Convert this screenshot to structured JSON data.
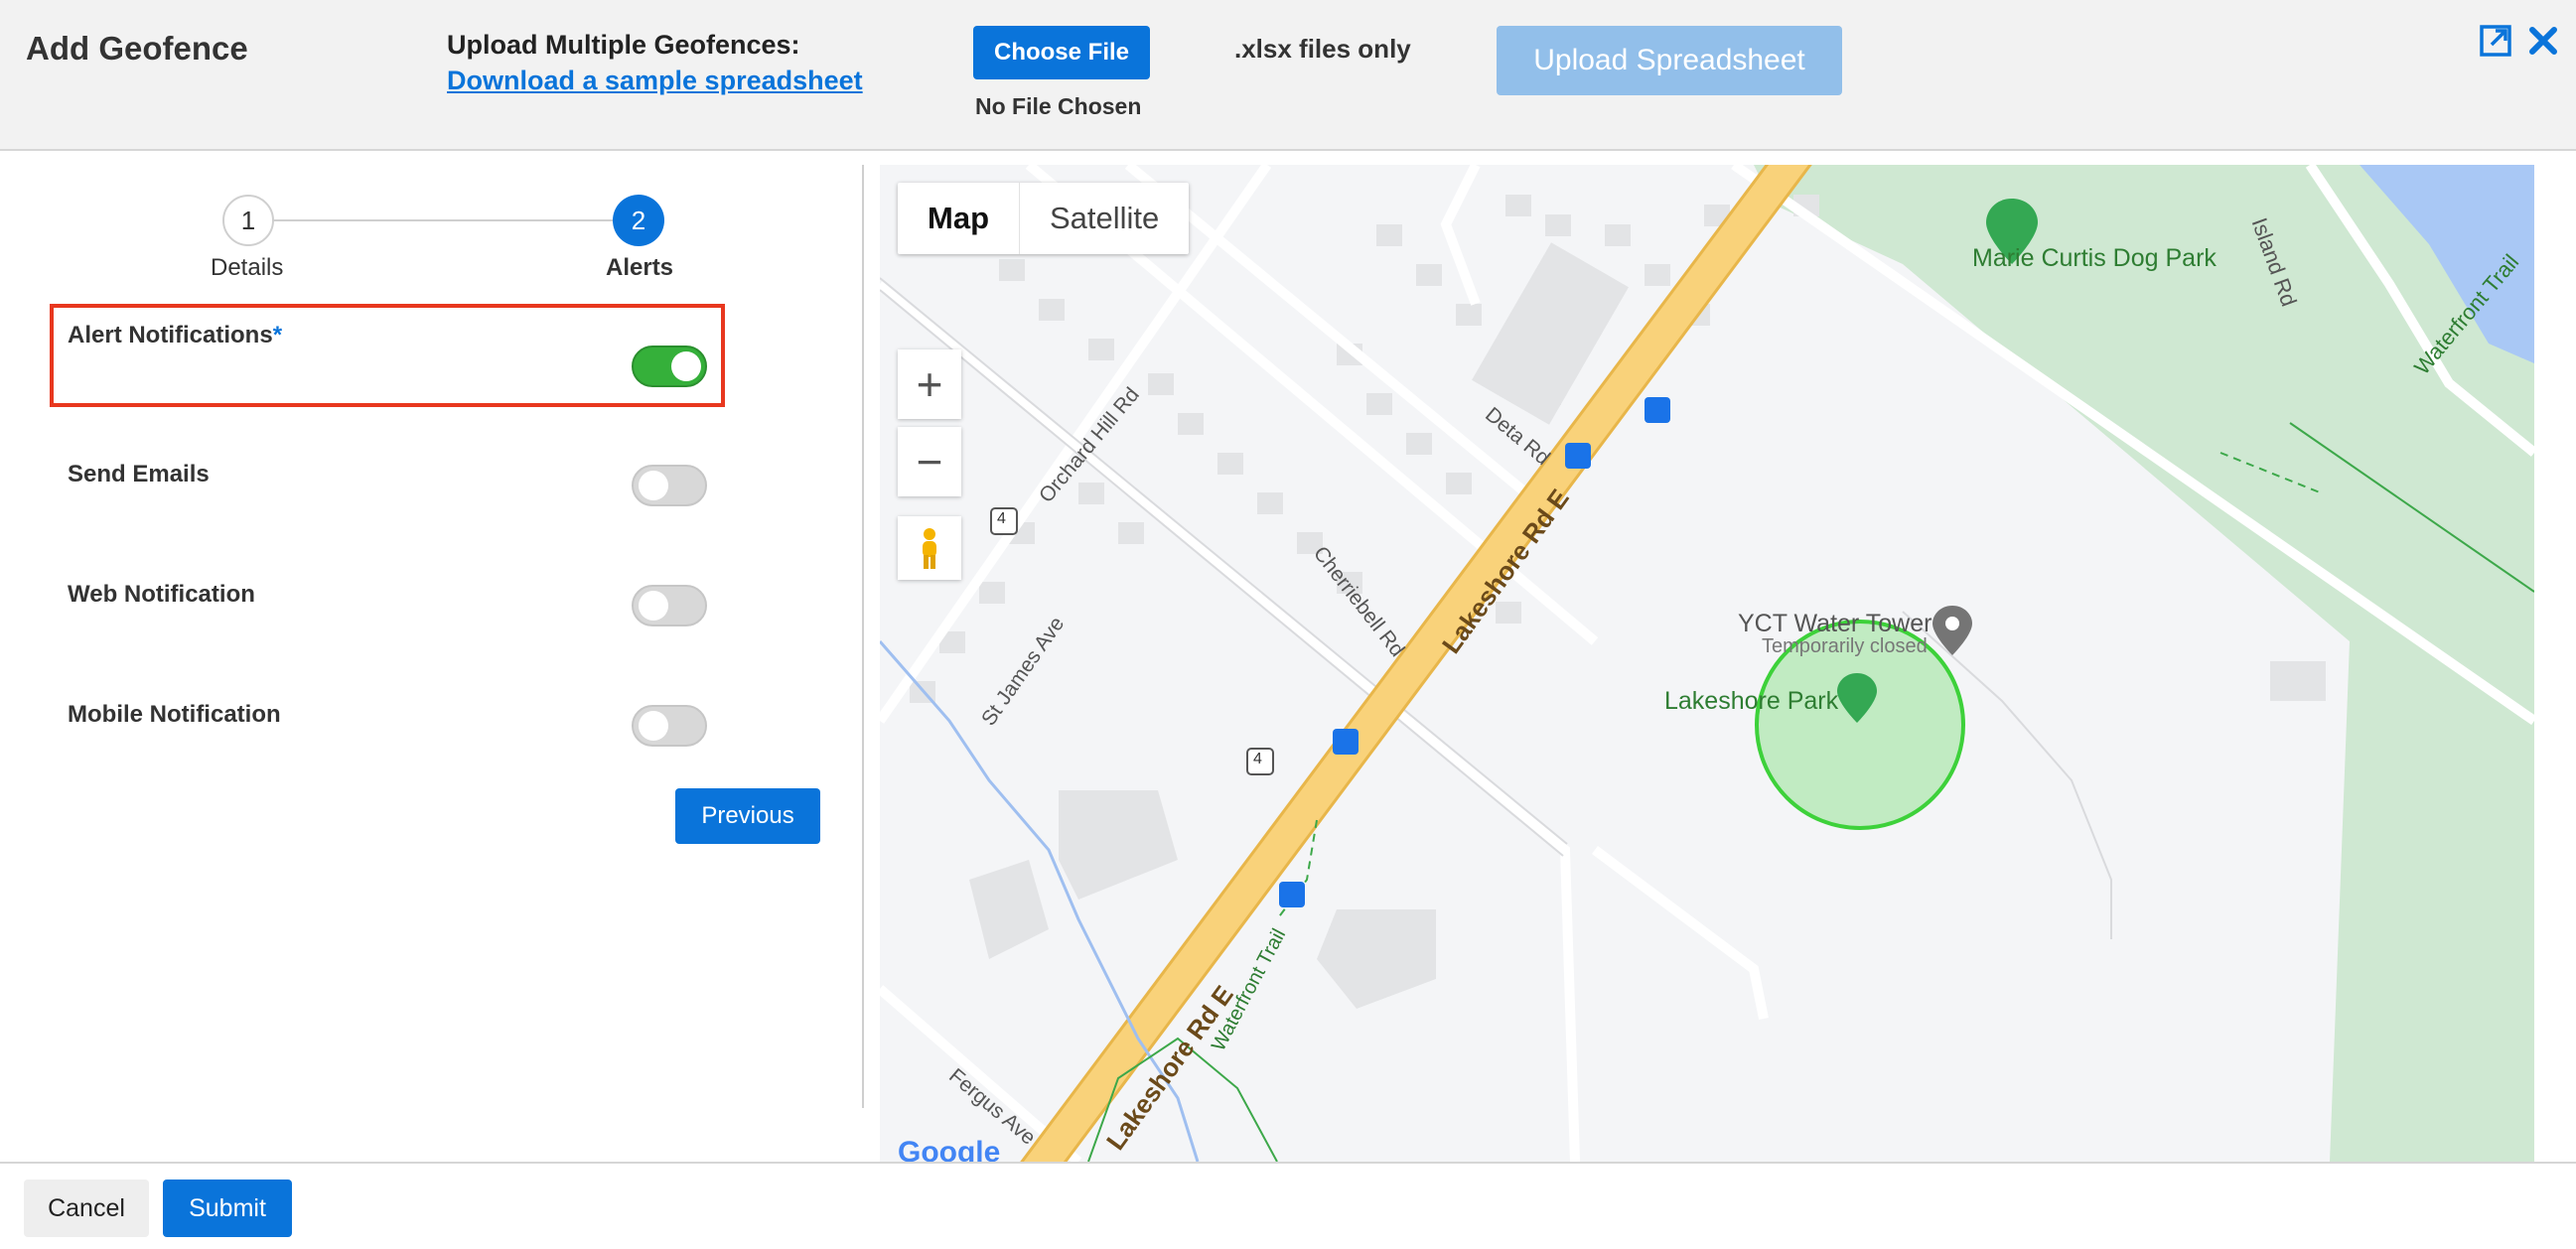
{
  "header": {
    "title": "Add Geofence",
    "upload_label": "Upload Multiple Geofences:",
    "sample_link": "Download a sample spreadsheet",
    "choose_file": "Choose File",
    "no_file": "No File Chosen",
    "file_note": ".xlsx files only",
    "upload_button": "Upload Spreadsheet"
  },
  "stepper": {
    "steps": [
      {
        "number": "1",
        "label": "Details"
      },
      {
        "number": "2",
        "label": "Alerts"
      }
    ],
    "active_step": 2
  },
  "alerts": {
    "required_mark": "*",
    "rows": [
      {
        "label": "Alert Notifications",
        "enabled": true
      },
      {
        "label": "Send Emails",
        "enabled": false
      },
      {
        "label": "Web Notification",
        "enabled": false
      },
      {
        "label": "Mobile Notification",
        "enabled": false
      }
    ],
    "previous_button": "Previous"
  },
  "map": {
    "type_buttons": [
      "Map",
      "Satellite"
    ],
    "active_type": "Map",
    "zoom_in": "+",
    "zoom_out": "−",
    "google_logo": "Google",
    "labels": {
      "dog_park": "Marie Curtis Dog Park",
      "island_rd": "Island Rd",
      "waterfront_trail": "Waterfront Trail",
      "water_tower": "YCT Water Tower",
      "temporarily_closed": "Temporarily closed",
      "lakeshore_park": "Lakeshore Park",
      "lakeshore_rd": "Lakeshore Rd E",
      "orchard_hill": "Orchard Hill Rd",
      "deta_rd": "Deta Rd",
      "cherriebell": "Cherriebell Rd",
      "st_james": "St James Ave",
      "fergus": "Fergus Ave",
      "route_4": "4"
    },
    "colors": {
      "park": "#cfe8d2",
      "road_major": "#f9d27a",
      "water": "#a9c8f5",
      "geofence": "#3dd13a"
    }
  },
  "footer": {
    "cancel": "Cancel",
    "submit": "Submit"
  }
}
